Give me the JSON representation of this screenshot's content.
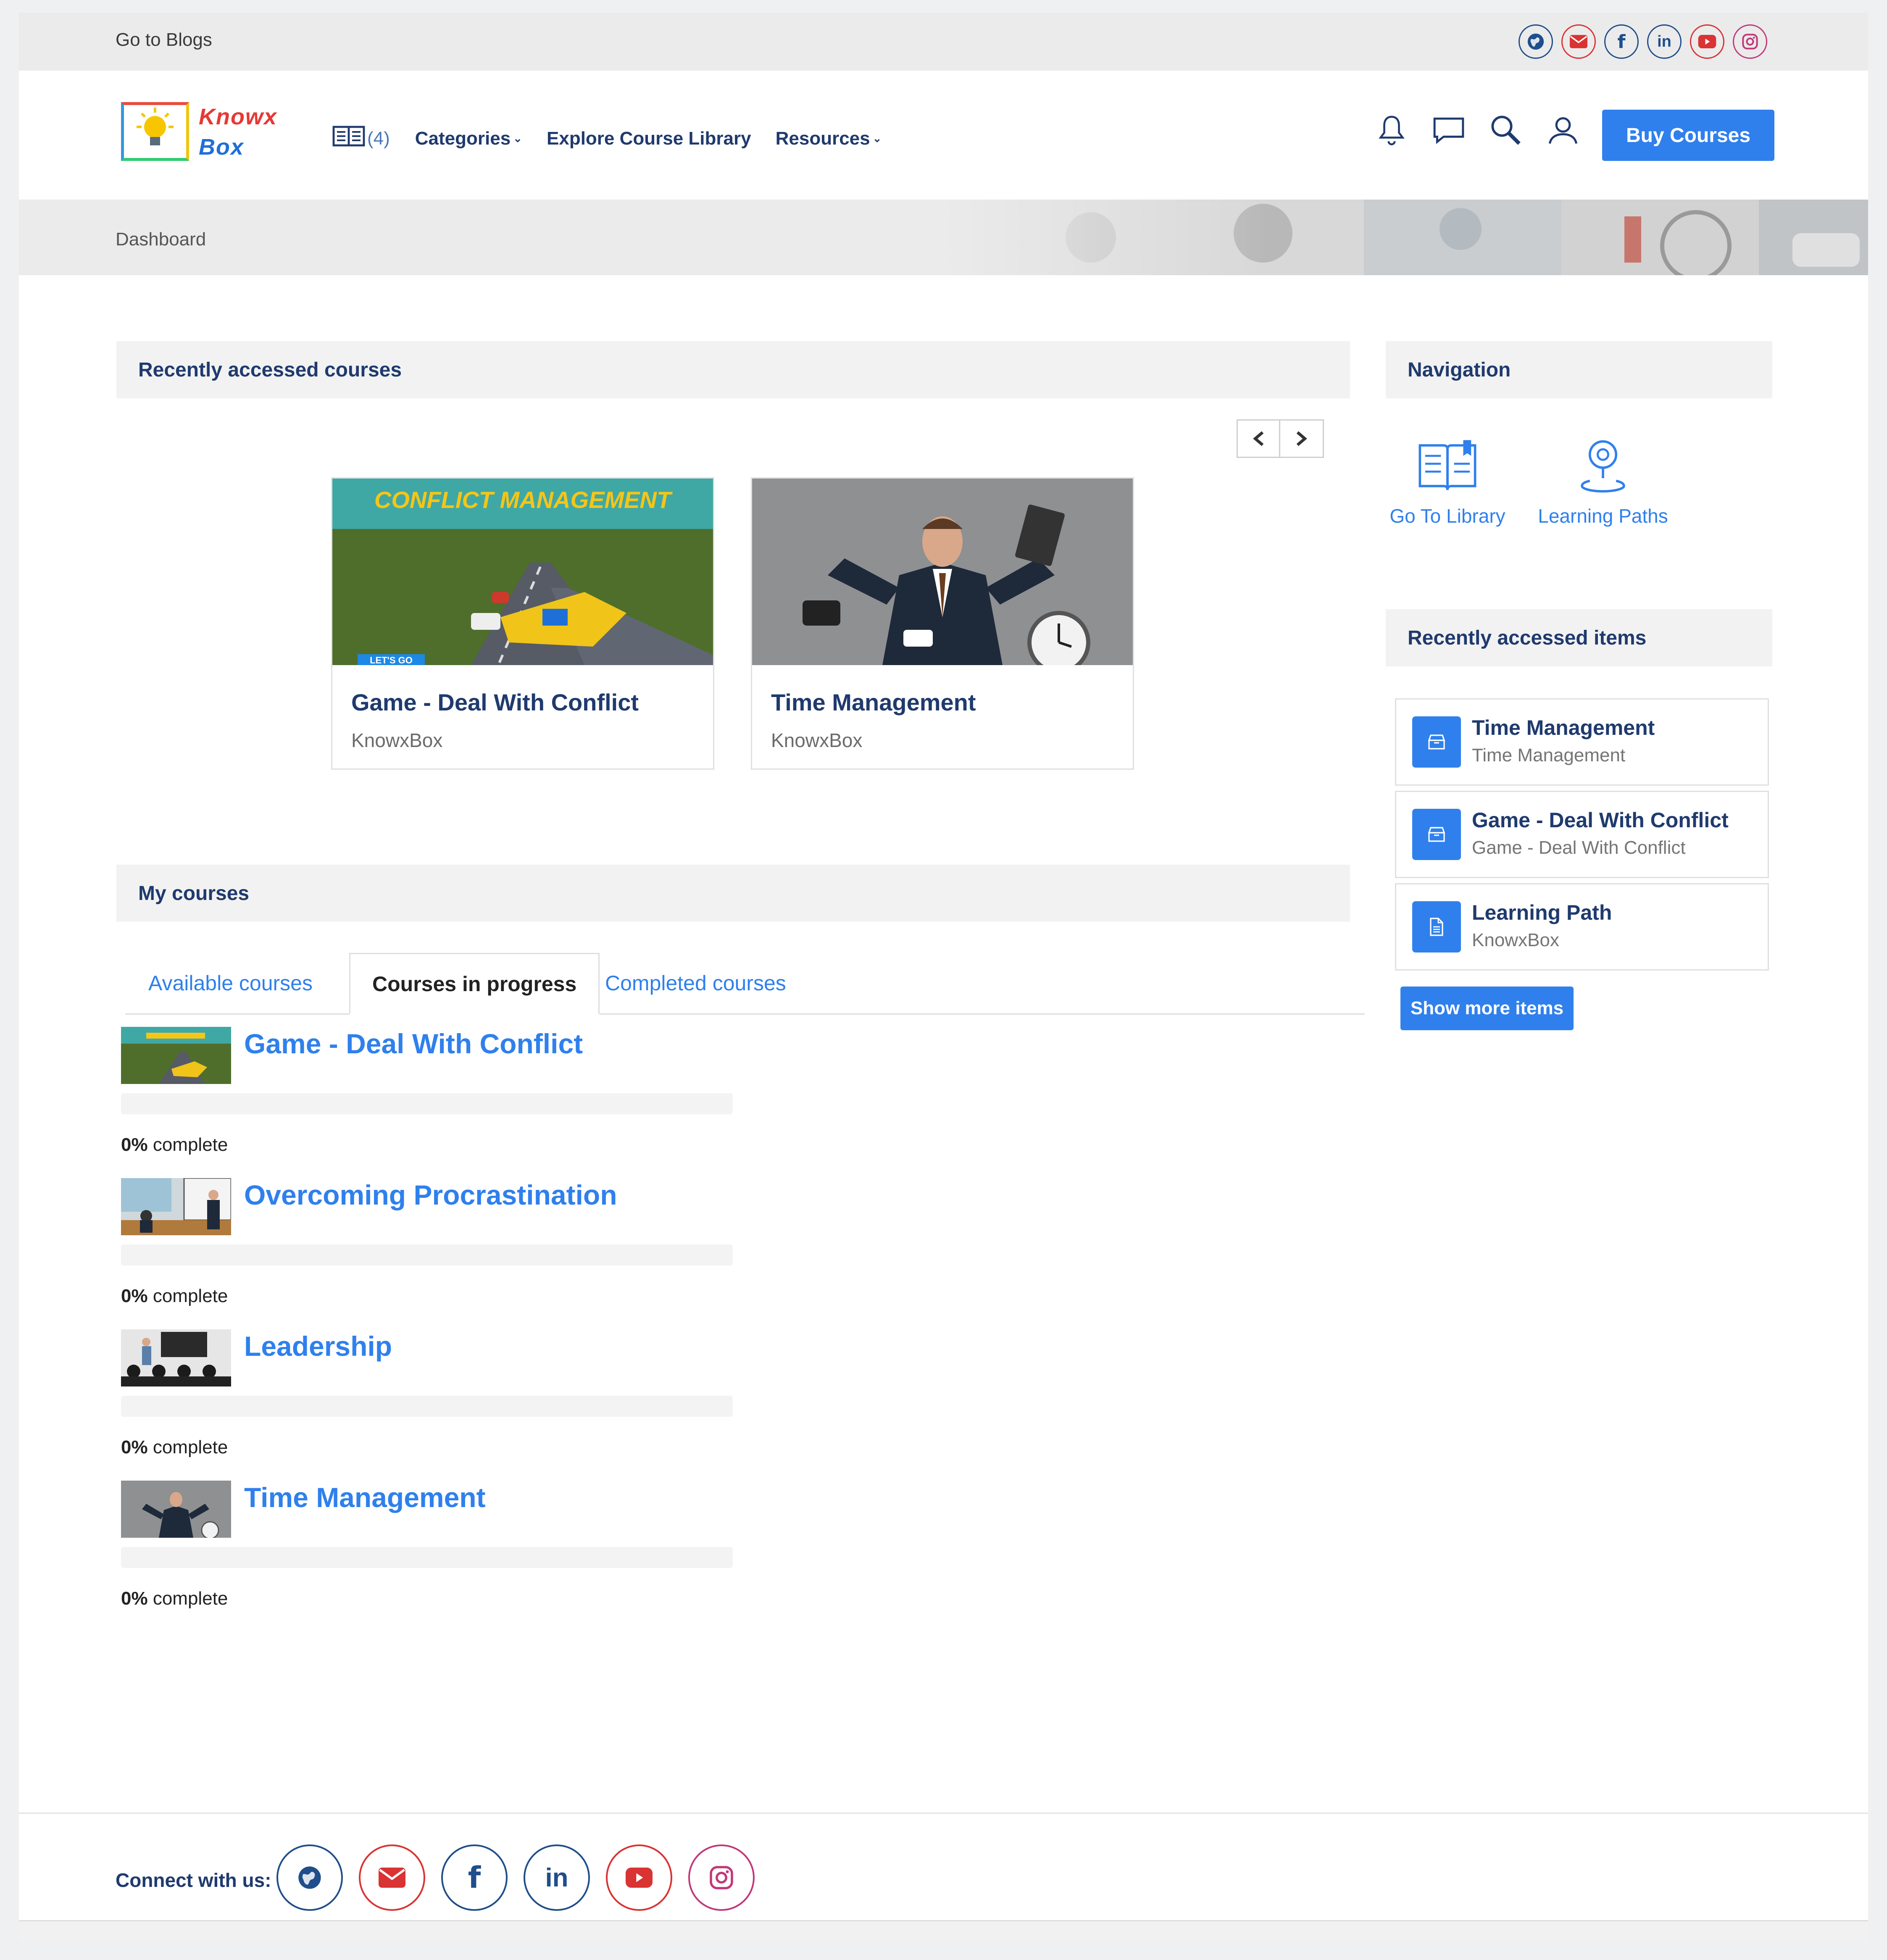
{
  "topbar": {
    "blogs_link": "Go to Blogs",
    "social": [
      "globe-icon",
      "email-icon",
      "facebook-icon",
      "linkedin-icon",
      "youtube-icon",
      "instagram-icon"
    ]
  },
  "header": {
    "logo_line1": "Knowx",
    "logo_line2": "Box",
    "cart_count": "(4)",
    "nav": {
      "categories": "Categories",
      "explore": "Explore Course Library",
      "resources": "Resources"
    },
    "icons": [
      "bell-icon",
      "chat-icon",
      "search-icon",
      "user-icon"
    ],
    "buy_button": "Buy Courses"
  },
  "banner": {
    "title": "Dashboard"
  },
  "recent_courses": {
    "heading": "Recently accessed courses",
    "cards": [
      {
        "thumb_title": "CONFLICT MANAGEMENT",
        "thumb_badge": "LET'S GO",
        "title": "Game - Deal With Conflict",
        "org": "KnowxBox"
      },
      {
        "title": "Time Management",
        "org": "KnowxBox"
      }
    ]
  },
  "my_courses": {
    "heading": "My courses",
    "tabs": {
      "available": "Available courses",
      "in_progress": "Courses in progress",
      "completed": "Completed courses"
    },
    "items": [
      {
        "title": "Game - Deal With Conflict",
        "progress": 0,
        "pct": "0%",
        "suffix": " complete"
      },
      {
        "title": "Overcoming Procrastination",
        "progress": 0,
        "pct": "0%",
        "suffix": " complete"
      },
      {
        "title": "Leadership",
        "progress": 0,
        "pct": "0%",
        "suffix": " complete"
      },
      {
        "title": "Time Management",
        "progress": 0,
        "pct": "0%",
        "suffix": " complete"
      }
    ]
  },
  "navigation": {
    "heading": "Navigation",
    "links": [
      {
        "label": "Go To Library",
        "icon": "book-icon"
      },
      {
        "label": "Learning Paths",
        "icon": "location-pin-icon"
      }
    ]
  },
  "recent_items": {
    "heading": "Recently accessed items",
    "items": [
      {
        "title": "Time Management",
        "subtitle": "Time Management",
        "icon": "package-icon"
      },
      {
        "title": "Game - Deal With Conflict",
        "subtitle": "Game - Deal With Conflict",
        "icon": "package-icon"
      },
      {
        "title": "Learning Path",
        "subtitle": "KnowxBox",
        "icon": "document-icon"
      }
    ],
    "show_more": "Show more items"
  },
  "footer": {
    "connect_label": "Connect with us:",
    "social": [
      "globe-icon",
      "email-icon",
      "facebook-icon",
      "linkedin-icon",
      "youtube-icon",
      "instagram-icon"
    ]
  },
  "colors": {
    "accent": "#2f80ed",
    "navy": "#1f3a6e",
    "social_blue": "#1f4e8c",
    "social_red": "#d93333",
    "social_instagram": "#c1387a"
  }
}
